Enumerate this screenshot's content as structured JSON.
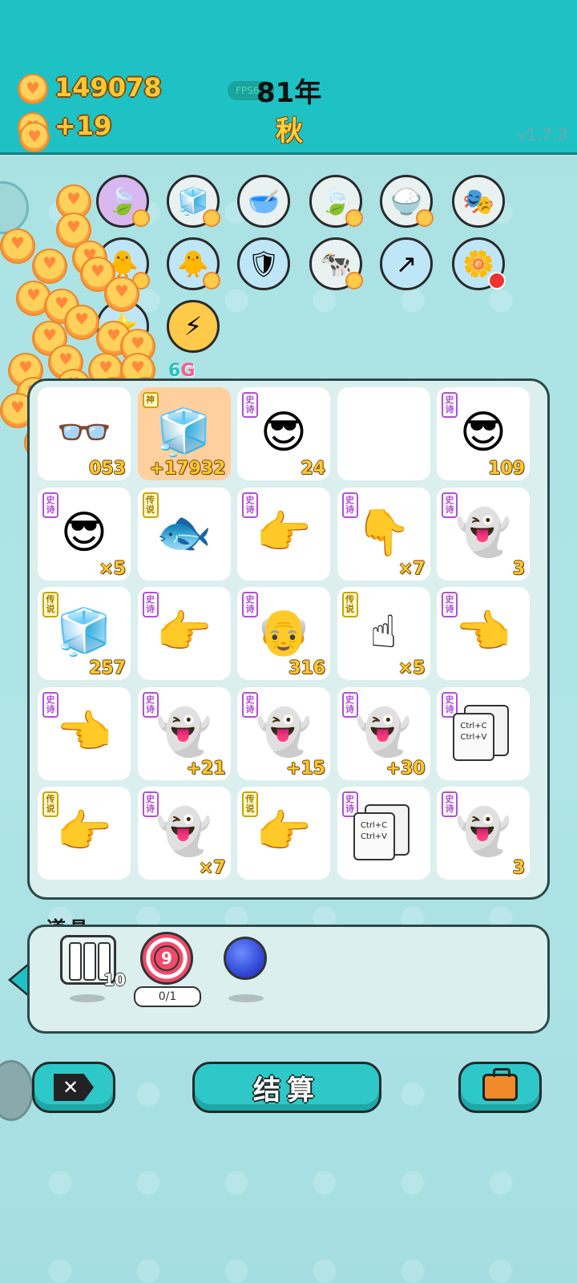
{
  "hud": {
    "coins": "149078",
    "income": "+19",
    "fps": "FPS6",
    "year": "81年",
    "season": "秋",
    "version": "v1.7.3"
  },
  "skills": [
    {
      "name": "leaf-skill",
      "icon": "🍃"
    },
    {
      "name": "tofu-skill",
      "icon": "🧊"
    },
    {
      "name": "dog-bowl-skill",
      "icon": "🥣"
    },
    {
      "name": "leaf-skill-2",
      "icon": "🍃"
    },
    {
      "name": "rice-skill",
      "icon": "🍚"
    },
    {
      "name": "mask-skill",
      "icon": "🎭"
    },
    {
      "name": "chick-skill",
      "icon": "🐥"
    },
    {
      "name": "chick-skill-2",
      "icon": "🐥"
    },
    {
      "name": "shield-skill",
      "icon": "🛡"
    },
    {
      "name": "cow-skill",
      "icon": "🐄"
    },
    {
      "name": "upgrade-skill",
      "icon": "↗"
    },
    {
      "name": "flower-skill",
      "icon": "🌼"
    },
    {
      "name": "star-skill",
      "icon": "⭐"
    },
    {
      "name": "lightning-skill",
      "icon": "⚡"
    }
  ],
  "board": {
    "gen_label_a": "6",
    "gen_label_b": "G",
    "cells": [
      {
        "tag": "",
        "icon": "👓",
        "count": "053"
      },
      {
        "tag": "神",
        "icon": "🧊",
        "count": "+17932"
      },
      {
        "tag": "史诗",
        "icon": "😎",
        "count": "24"
      },
      {
        "tag": "",
        "icon": "",
        "count": ""
      },
      {
        "tag": "史诗",
        "icon": "😎",
        "count": "109"
      },
      {
        "tag": "史诗",
        "icon": "😎",
        "count": "×5"
      },
      {
        "tag": "传说",
        "icon": "🐟",
        "count": ""
      },
      {
        "tag": "史诗",
        "icon": "👉",
        "count": ""
      },
      {
        "tag": "史诗",
        "icon": "👇",
        "count": "×7"
      },
      {
        "tag": "史诗",
        "icon": "👻",
        "count": "3"
      },
      {
        "tag": "传说",
        "icon": "🧊",
        "count": "257"
      },
      {
        "tag": "史诗",
        "icon": "👉",
        "count": ""
      },
      {
        "tag": "史诗",
        "icon": "👴",
        "count": "316"
      },
      {
        "tag": "传说",
        "icon": "☝",
        "count": "×5"
      },
      {
        "tag": "史诗",
        "icon": "👈",
        "count": ""
      },
      {
        "tag": "史诗",
        "icon": "👈",
        "count": ""
      },
      {
        "tag": "史诗",
        "icon": "👻",
        "count": "+21"
      },
      {
        "tag": "史诗",
        "icon": "👻",
        "count": "+15"
      },
      {
        "tag": "史诗",
        "icon": "👻",
        "count": "+30"
      },
      {
        "tag": "史诗",
        "icon": "ctrl",
        "count": ""
      },
      {
        "tag": "传说",
        "icon": "👉",
        "count": ""
      },
      {
        "tag": "史诗",
        "icon": "👻",
        "count": "×7"
      },
      {
        "tag": "传说",
        "icon": "👉",
        "count": ""
      },
      {
        "tag": "史诗",
        "icon": "ctrl",
        "count": ""
      },
      {
        "tag": "史诗",
        "icon": "👻",
        "count": "3"
      }
    ],
    "ctrl_c": "Ctrl+C",
    "ctrl_v": "Ctrl+V"
  },
  "items": {
    "title": "道具",
    "slots": [
      {
        "name": "cage-item",
        "count": "10"
      },
      {
        "name": "target-item",
        "number": "9",
        "progress": "0/1"
      },
      {
        "name": "blueberry-item"
      }
    ]
  },
  "buttons": {
    "settle": "结算"
  }
}
